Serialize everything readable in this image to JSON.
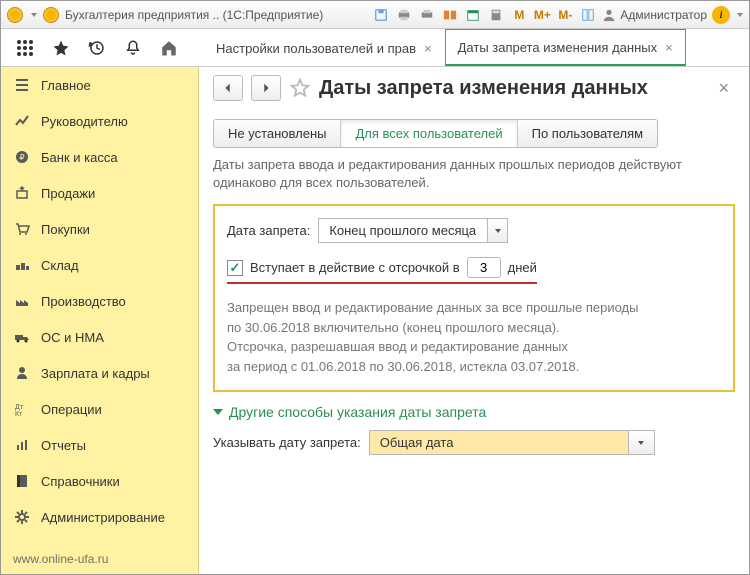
{
  "titlebar": {
    "app_title": "Бухгалтерия предприятия .. (1С:Предприятие)",
    "user_label": "Администратор"
  },
  "tabs": [
    {
      "label": "Настройки пользователей и прав",
      "active": false
    },
    {
      "label": "Даты запрета изменения данных",
      "active": true
    }
  ],
  "sidebar": {
    "items": [
      "Главное",
      "Руководителю",
      "Банк и касса",
      "Продажи",
      "Покупки",
      "Склад",
      "Производство",
      "ОС и НМА",
      "Зарплата и кадры",
      "Операции",
      "Отчеты",
      "Справочники",
      "Администрирование"
    ],
    "footer": "www.online-ufa.ru"
  },
  "page": {
    "title": "Даты запрета изменения данных",
    "tabs": {
      "none": "Не установлены",
      "all": "Для всех пользователей",
      "by_user": "По пользователям"
    },
    "desc": "Даты запрета ввода и редактирования данных прошлых периодов действуют одинаково для всех пользователей.",
    "date_label": "Дата запрета:",
    "date_value": "Конец прошлого месяца",
    "delay_checkbox": "Вступает в действие с отсрочкой в",
    "delay_value": "3",
    "delay_suffix": "дней",
    "info_l1": "Запрещен ввод и редактирование данных за все прошлые периоды",
    "info_l2": "по 30.06.2018 включительно (конец прошлого месяца).",
    "info_l3": "Отсрочка, разрешавшая ввод и редактирование данных",
    "info_l4": "за период с 01.06.2018 по 30.06.2018, истекла 03.07.2018.",
    "expander": "Другие способы указания даты запрета",
    "mode_label": "Указывать дату запрета:",
    "mode_value": "Общая дата"
  }
}
